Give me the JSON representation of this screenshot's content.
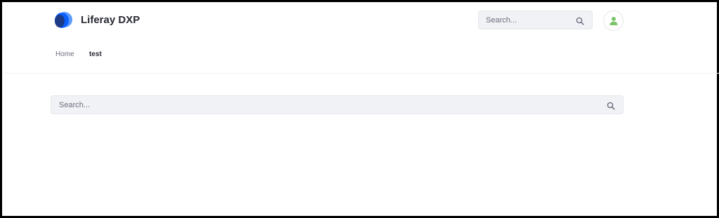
{
  "header": {
    "site_name": "Liferay DXP",
    "search": {
      "placeholder": "Search..."
    }
  },
  "nav": {
    "items": [
      {
        "label": "Home"
      },
      {
        "label": "test"
      }
    ]
  },
  "main": {
    "search": {
      "placeholder": "Search..."
    }
  },
  "icons": {
    "logo": "liferay-logo-icon",
    "search": "search-icon",
    "user": "user-icon"
  },
  "colors": {
    "logo_dark": "#0b5fff",
    "logo_navy": "#1c3a85",
    "logo_light": "#5b9bff",
    "user_icon": "#7cc46a",
    "search_bg": "#f1f2f5",
    "text_primary": "#272833",
    "text_secondary": "#6b6c7e"
  }
}
